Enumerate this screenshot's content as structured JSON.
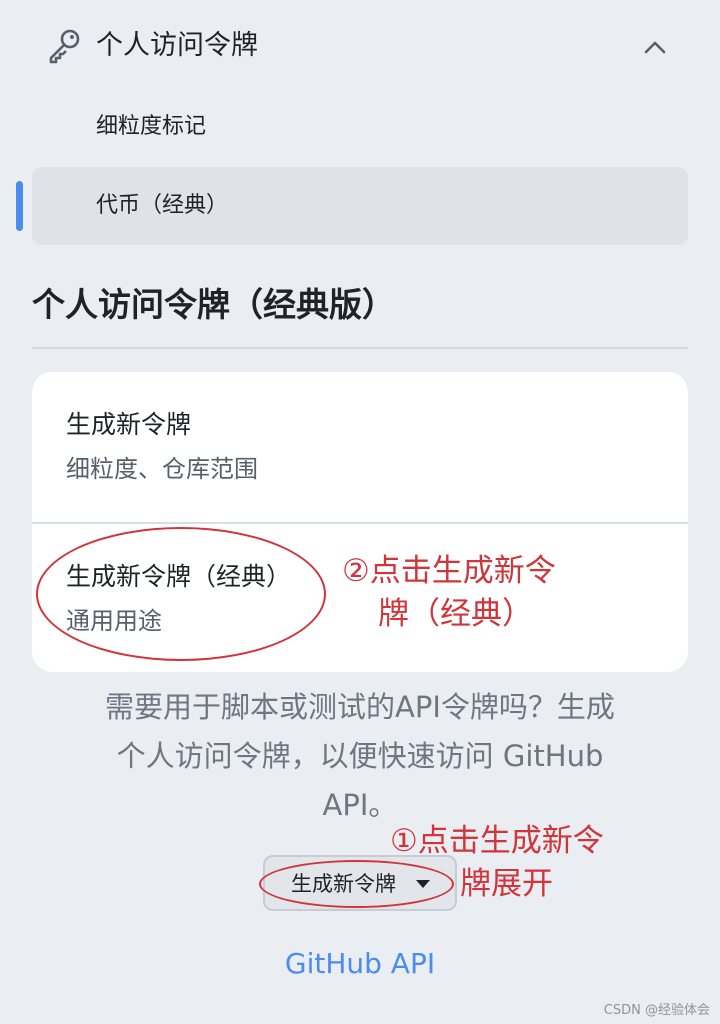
{
  "nav": {
    "section_title": "个人访问令牌",
    "sub_items": [
      "细粒度标记",
      "代币（经典）"
    ],
    "active_index": 1
  },
  "page": {
    "title": "个人访问令牌（经典版）"
  },
  "menu": {
    "items": [
      {
        "title": "生成新令牌",
        "description": "细粒度、仓库范围"
      },
      {
        "title": "生成新令牌（经典）",
        "description": "通用用途"
      }
    ]
  },
  "help": {
    "text": "需要用于脚本或测试的API令牌吗？生成个人访问令牌，以便快速访问 GitHub API。"
  },
  "button": {
    "label": "生成新令牌"
  },
  "link": {
    "api": "GitHub API"
  },
  "annotations": {
    "step1_line1": "①点击生成新令",
    "step1_line2": "牌展开",
    "step2_line1": "②点击生成新令",
    "step2_line2": "牌（经典）"
  },
  "watermark": "CSDN @经验体会",
  "colors": {
    "accent": "#4a8cf0",
    "annotation": "#d0353a",
    "background": "#eaedf1"
  },
  "icons": {
    "nav": "key-icon",
    "toggle": "chevron-up-icon",
    "dropdown": "caret-down-icon"
  }
}
